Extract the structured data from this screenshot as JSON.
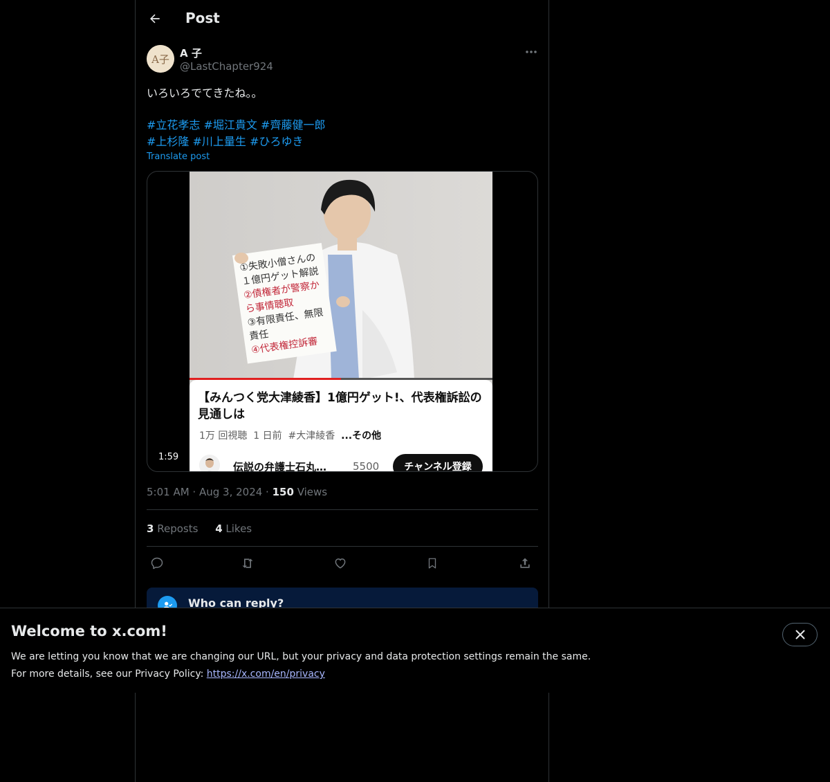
{
  "header": {
    "title": "Post",
    "back_icon": "arrow-left-icon"
  },
  "post": {
    "display_name": "A 子",
    "handle": "@LastChapter924",
    "avatar_text": "A子",
    "text": "いろいろでてきたね。。",
    "hashtags_line1": [
      "#立花孝志",
      "#堀江貴文",
      "#齊藤健一郎"
    ],
    "hashtags_line2": [
      "#上杉隆",
      "#川上量生",
      "#ひろゆき"
    ],
    "translate_label": "Translate post",
    "time": "5:01 AM",
    "date": "Aug 3, 2024",
    "views_count": "150",
    "views_label": "Views",
    "reposts_count": "3",
    "reposts_label": "Reposts",
    "likes_count": "4",
    "likes_label": "Likes"
  },
  "media": {
    "duration": "1:59",
    "playback_progress": 0.5,
    "sign_lines": [
      "①失敗小僧さんの",
      "１億円ゲット解説",
      "②債権者が警察か",
      "ら事情聴取",
      "③有限責任、無限",
      "責任",
      "④代表権控訴審"
    ],
    "yt_title": "【みんつく党大津綾香】1億円ゲット!、代表権訴訟の見通しは",
    "yt_views": "1万 回視聴",
    "yt_age": "1 日前",
    "yt_tag": "#大津綾香",
    "yt_more": "...その他",
    "channel_name": "伝説の弁護士石丸…",
    "subscriber_count": "5500",
    "subscribe_label": "チャンネル登録"
  },
  "reply_box": {
    "title": "Who can reply?"
  },
  "banner": {
    "title": "Welcome to x.com!",
    "line1": "We are letting you know that we are changing our URL, but your privacy and data protection settings remain the same.",
    "line2_prefix": "For more details, see our Privacy Policy: ",
    "link": "https://x.com/en/privacy"
  },
  "colors": {
    "accent": "#1d9bf0",
    "background": "#000000",
    "muted": "#71767b",
    "border": "#2f3336"
  }
}
